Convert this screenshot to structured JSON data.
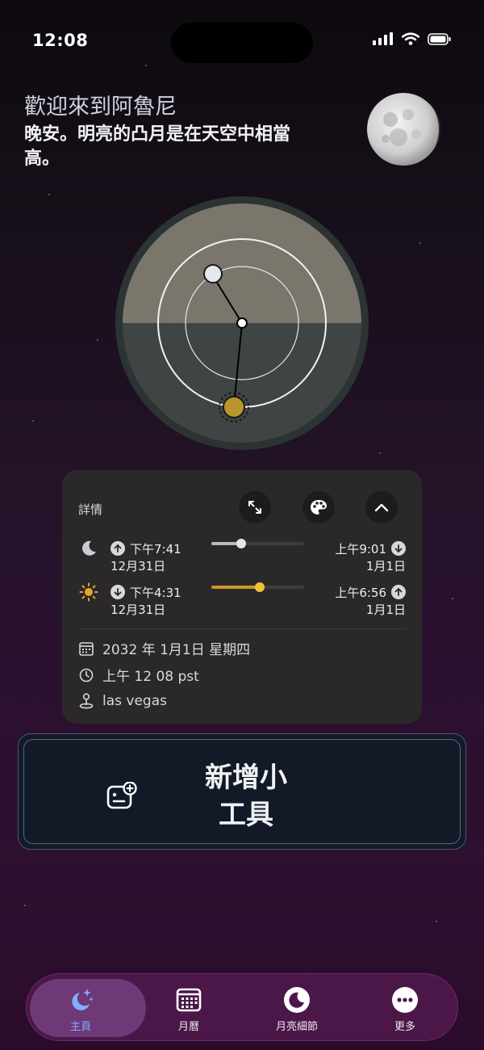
{
  "status_bar": {
    "time": "12:08"
  },
  "header": {
    "title": "歡迎來到阿魯尼",
    "subtitle": "晚安。明亮的凸月是在天空中相當高。"
  },
  "details": {
    "title": "詳情",
    "moon": {
      "rise_time": "下午7:41",
      "rise_date": "12月31日",
      "set_time": "上午9:01",
      "set_date": "1月1日",
      "progress": 0.32
    },
    "sun": {
      "set_time": "下午4:31",
      "set_date": "12月31日",
      "rise_time": "上午6:56",
      "rise_date": "1月1日",
      "progress": 0.52
    },
    "date": "2032 年 1月1日 星期四",
    "time": "上午 12 08 pst",
    "location": "las vegas"
  },
  "add_widget": {
    "label": "新增小工具"
  },
  "tabs": [
    {
      "label": "主頁",
      "icon": "moon-stars-icon",
      "active": true
    },
    {
      "label": "月曆",
      "icon": "calendar-icon",
      "active": false
    },
    {
      "label": "月亮細節",
      "icon": "moon-detail-icon",
      "active": false
    },
    {
      "label": "更多",
      "icon": "more-icon",
      "active": false
    }
  ],
  "colors": {
    "moon_track": "#b8bac2",
    "sun_track": "#c79a25",
    "active_tab": "#7fb0ff"
  }
}
